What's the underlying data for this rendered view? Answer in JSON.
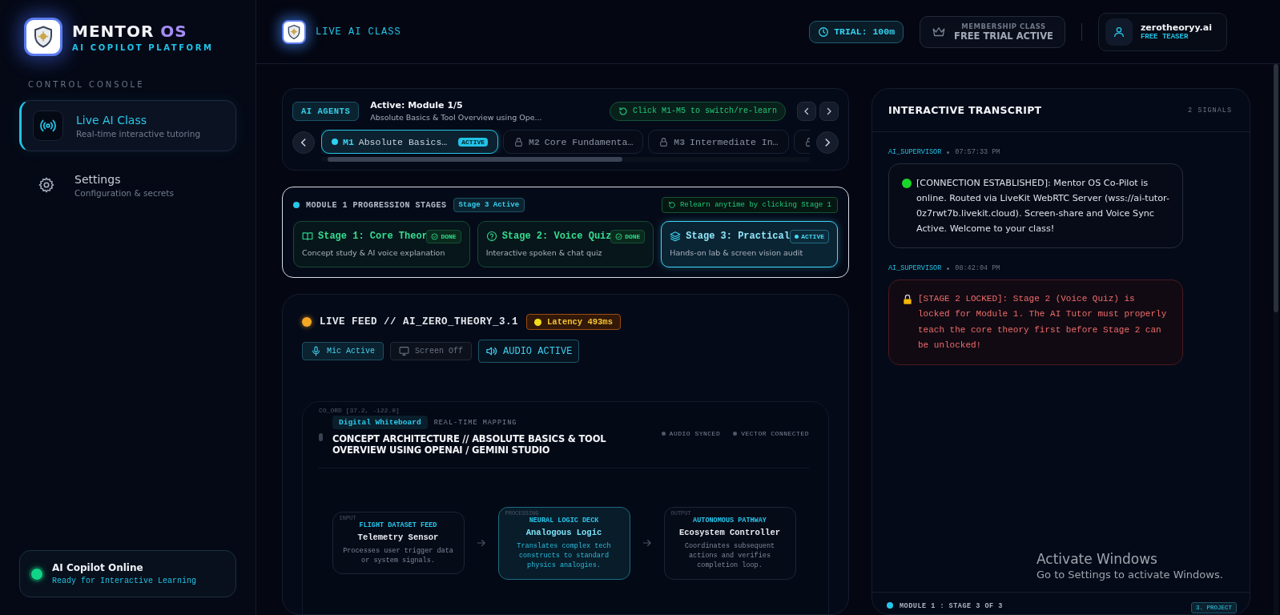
{
  "brand": {
    "title": "MENTOR",
    "title_accent": "OS",
    "subtitle": "AI COPILOT PLATFORM"
  },
  "sidebar": {
    "section_label": "CONTROL CONSOLE",
    "items": [
      {
        "label": "Live AI Class",
        "description": "Real-time interactive tutoring",
        "selected": true
      },
      {
        "label": "Settings",
        "description": "Configuration & secrets",
        "selected": false
      }
    ]
  },
  "status_card": {
    "title": "AI Copilot Online",
    "subtitle": "Ready for Interactive Learning",
    "online": true
  },
  "header": {
    "title": "LIVE AI CLASS",
    "trial": "TRIAL: 100m",
    "membership": {
      "label": "MEMBERSHIP CLASS",
      "value": "FREE TRIAL ACTIVE"
    },
    "user": {
      "name": "zerotheoryy.ai",
      "plan": "FREE TEASER"
    }
  },
  "modules": {
    "badge": "AI AGENTS",
    "active_title": "Active: Module 1/5",
    "active_subtitle": "Absolute Basics & Tool Overview using Ope...",
    "hint": "Click M1-M5 to switch/re-learn",
    "tabs": [
      {
        "code": "M1",
        "label": "Absolute Basics…",
        "badge": "ACTIVE",
        "selected": true,
        "locked": false
      },
      {
        "code": "M2",
        "label": "Core Fundamenta…",
        "selected": false,
        "locked": true
      },
      {
        "code": "M3",
        "label": "Intermediate In…",
        "selected": false,
        "locked": true
      },
      {
        "selected": false,
        "locked": true
      }
    ]
  },
  "stages": {
    "title": "MODULE 1 PROGRESSION STAGES",
    "active_badge": "Stage 3 Active",
    "hint": "Relearn anytime by clicking Stage 1",
    "items": [
      {
        "title": "Stage 1: Core Theor",
        "description": "Concept study & AI voice explanation",
        "kind": "done",
        "badge": "DONE",
        "selected": false
      },
      {
        "title": "Stage 2: Voice Quiz",
        "description": "Interactive spoken & chat quiz",
        "kind": "done",
        "badge": "DONE",
        "selected": false
      },
      {
        "title": "Stage 3: Practical",
        "description": "Hands-on lab & screen vision audit",
        "kind": "active",
        "badge": "ACTIVE",
        "selected": true
      }
    ]
  },
  "live_feed": {
    "title": "LIVE FEED // AI_ZERO_THEORY_3.1",
    "latency": "Latency 493ms",
    "controls": [
      {
        "kind": "toggle",
        "label": "Mic Active",
        "on": true
      },
      {
        "kind": "toggle",
        "label": "Screen Off",
        "on": false
      },
      {
        "kind": "audio",
        "label": "AUDIO ACTIVE",
        "on": true
      }
    ]
  },
  "whiteboard": {
    "coords": "CO_ORD [37.2, -122.0]",
    "badge": "Digital Whiteboard",
    "mode": "REAL-TIME MAPPING",
    "title": "CONCEPT ARCHITECTURE // ABSOLUTE BASICS & TOOL OVERVIEW USING OPENAI / GEMINI STUDIO",
    "indicators": [
      "AUDIO SYNCED",
      "VECTOR CONNECTED"
    ],
    "nodes": [
      {
        "tag": "INPUT",
        "category": "FLIGHT DATASET FEED",
        "name": "Telemetry Sensor",
        "description": "Processes user trigger data or system signals.",
        "selected": false
      },
      {
        "tag": "PROCESSING",
        "category": "NEURAL LOGIC DECK",
        "name": "Analogous Logic",
        "description": "Translates complex tech constructs to standard physics analogies.",
        "selected": true
      },
      {
        "tag": "OUTPUT",
        "category": "AUTONOMOUS PATHWAY",
        "name": "Ecosystem Controller",
        "description": "Coordinates subsequent actions and verifies completion loop.",
        "selected": false
      }
    ]
  },
  "transcript": {
    "title": "INTERACTIVE TRANSCRIPT",
    "count": "2 SIGNALS",
    "messages": [
      {
        "sender": "AI_SUPERVISOR",
        "time": "07:57:33 PM",
        "kind": "info",
        "text": "[CONNECTION ESTABLISHED]: Mentor OS Co-Pilot is online. Routed via LiveKit WebRTC Server (wss://ai-tutor-0z7rwt7b.livekit.cloud). Screen-share and Voice Sync Active. Welcome to your class!"
      },
      {
        "sender": "AI_SUPERVISOR",
        "time": "08:42:04 PM",
        "kind": "warning",
        "text": "[STAGE 2 LOCKED]: Stage 2 (Voice Quiz) is locked for Module 1. The AI Tutor must properly teach the core theory first before Stage 2 can be unlocked!"
      }
    ],
    "footer": {
      "label": "MODULE 1 : STAGE 3 OF 3",
      "badge": "3. PROJECT"
    }
  },
  "os_overlay": {
    "title": "Activate Windows",
    "subtitle": "Go to Settings to activate Windows."
  }
}
